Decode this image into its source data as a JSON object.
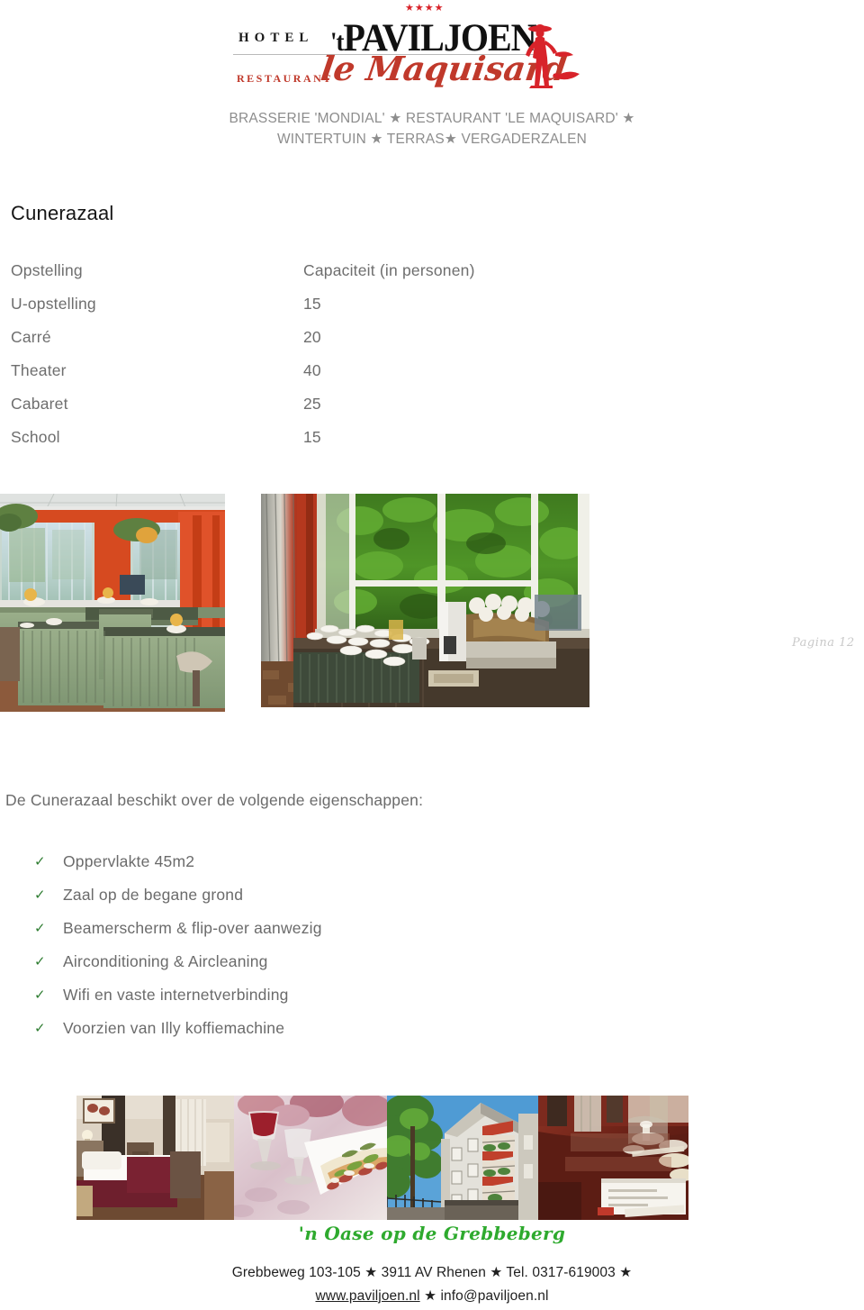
{
  "logo": {
    "stars": "★★★★",
    "hotel_word": "HOTEL",
    "name_prefix": "'t",
    "name_main": "PAVILJOEN",
    "restaurant_word": "RESTAURANT",
    "restaurant_name": "le Maquisard",
    "figure_icon": "maquisard-silhouette-icon",
    "accent_color": "#c0392b"
  },
  "header": {
    "line1": "BRASSERIE 'MONDIAL' ★  RESTAURANT 'LE MAQUISARD' ★",
    "line2": "WINTERTUIN ★ TERRAS★ VERGADERZALEN"
  },
  "room": {
    "title": "Cunerazaal"
  },
  "capacity_table": {
    "columns": [
      "Opstelling",
      "Capaciteit (in personen)"
    ],
    "rows": [
      {
        "opstelling": "U-opstelling",
        "capaciteit": "15"
      },
      {
        "opstelling": "Carré",
        "capaciteit": "20"
      },
      {
        "opstelling": "Theater",
        "capaciteit": "40"
      },
      {
        "opstelling": "Cabaret",
        "capaciteit": "25"
      },
      {
        "opstelling": "School",
        "capaciteit": "15"
      }
    ]
  },
  "photos_top": [
    {
      "name": "meeting-room-photo",
      "caption": "Vergaderzaal met groene tafelrokken en rode gordijnen"
    },
    {
      "name": "coffee-buffet-photo",
      "caption": "Koffiebuffet bij de ramen met groen uitzicht"
    }
  ],
  "page_label": "Pagina 12",
  "features": {
    "intro": "De Cunerazaal beschikt over de volgende eigenschappen:",
    "check_icon": "✓",
    "check_color": "#2f7d32",
    "items": [
      "Oppervlakte 45m2",
      "Zaal op de begane grond",
      "Beamerscherm & flip-over aanwezig",
      "Airconditioning & Aircleaning",
      "Wifi en vaste internetverbinding",
      "Voorzien van Illy koffiemachine"
    ]
  },
  "photos_bottom": [
    {
      "name": "hotel-bedroom-photo",
      "caption": "Hotelkamer met bed"
    },
    {
      "name": "wine-and-food-photo",
      "caption": "Glas rode wijn met gerecht"
    },
    {
      "name": "hotel-exterior-photo",
      "caption": "Voorgevel hotel met rode zonneschermen"
    },
    {
      "name": "table-setting-photo",
      "caption": "Gedekte tafel met menukaart"
    }
  ],
  "footer": {
    "tagline": "'n Oase op de Grebbeberg",
    "tagline_color": "#2eaa2e",
    "address_line": "Grebbeweg 103-105 ★ 3911 AV Rhenen ★ Tel. 0317-619003 ★",
    "website": "www.paviljoen.nl",
    "separator": "★",
    "email": "info@paviljoen.nl"
  }
}
